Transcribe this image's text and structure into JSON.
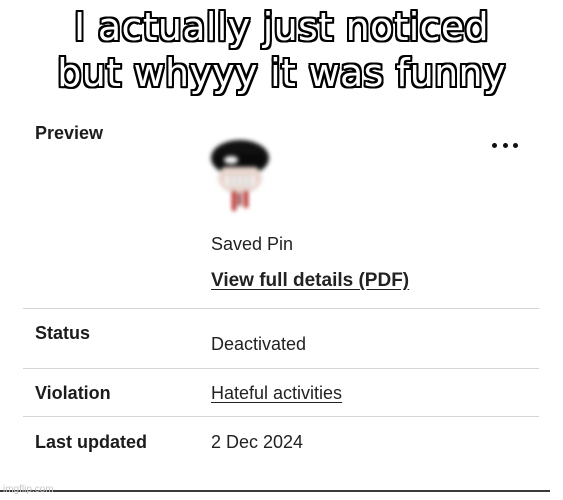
{
  "caption": {
    "line1": "I actually just noticed",
    "line2": "but whyyy it was funny"
  },
  "preview": {
    "label": "Preview",
    "thumbnail_icon": "skull-thumbnail-icon",
    "more_icon": "more-options-icon",
    "pin_type": "Saved Pin",
    "details_link": "View full details (PDF)"
  },
  "status": {
    "label": "Status",
    "value": "Deactivated"
  },
  "violation": {
    "label": "Violation",
    "value": "Hateful activities"
  },
  "last_updated": {
    "label": "Last updated",
    "value": "2 Dec 2024"
  },
  "watermark": "imgflip.com",
  "colors": {
    "text": "#1c1c1c",
    "divider": "#d6d6d6",
    "background": "#ffffff"
  }
}
